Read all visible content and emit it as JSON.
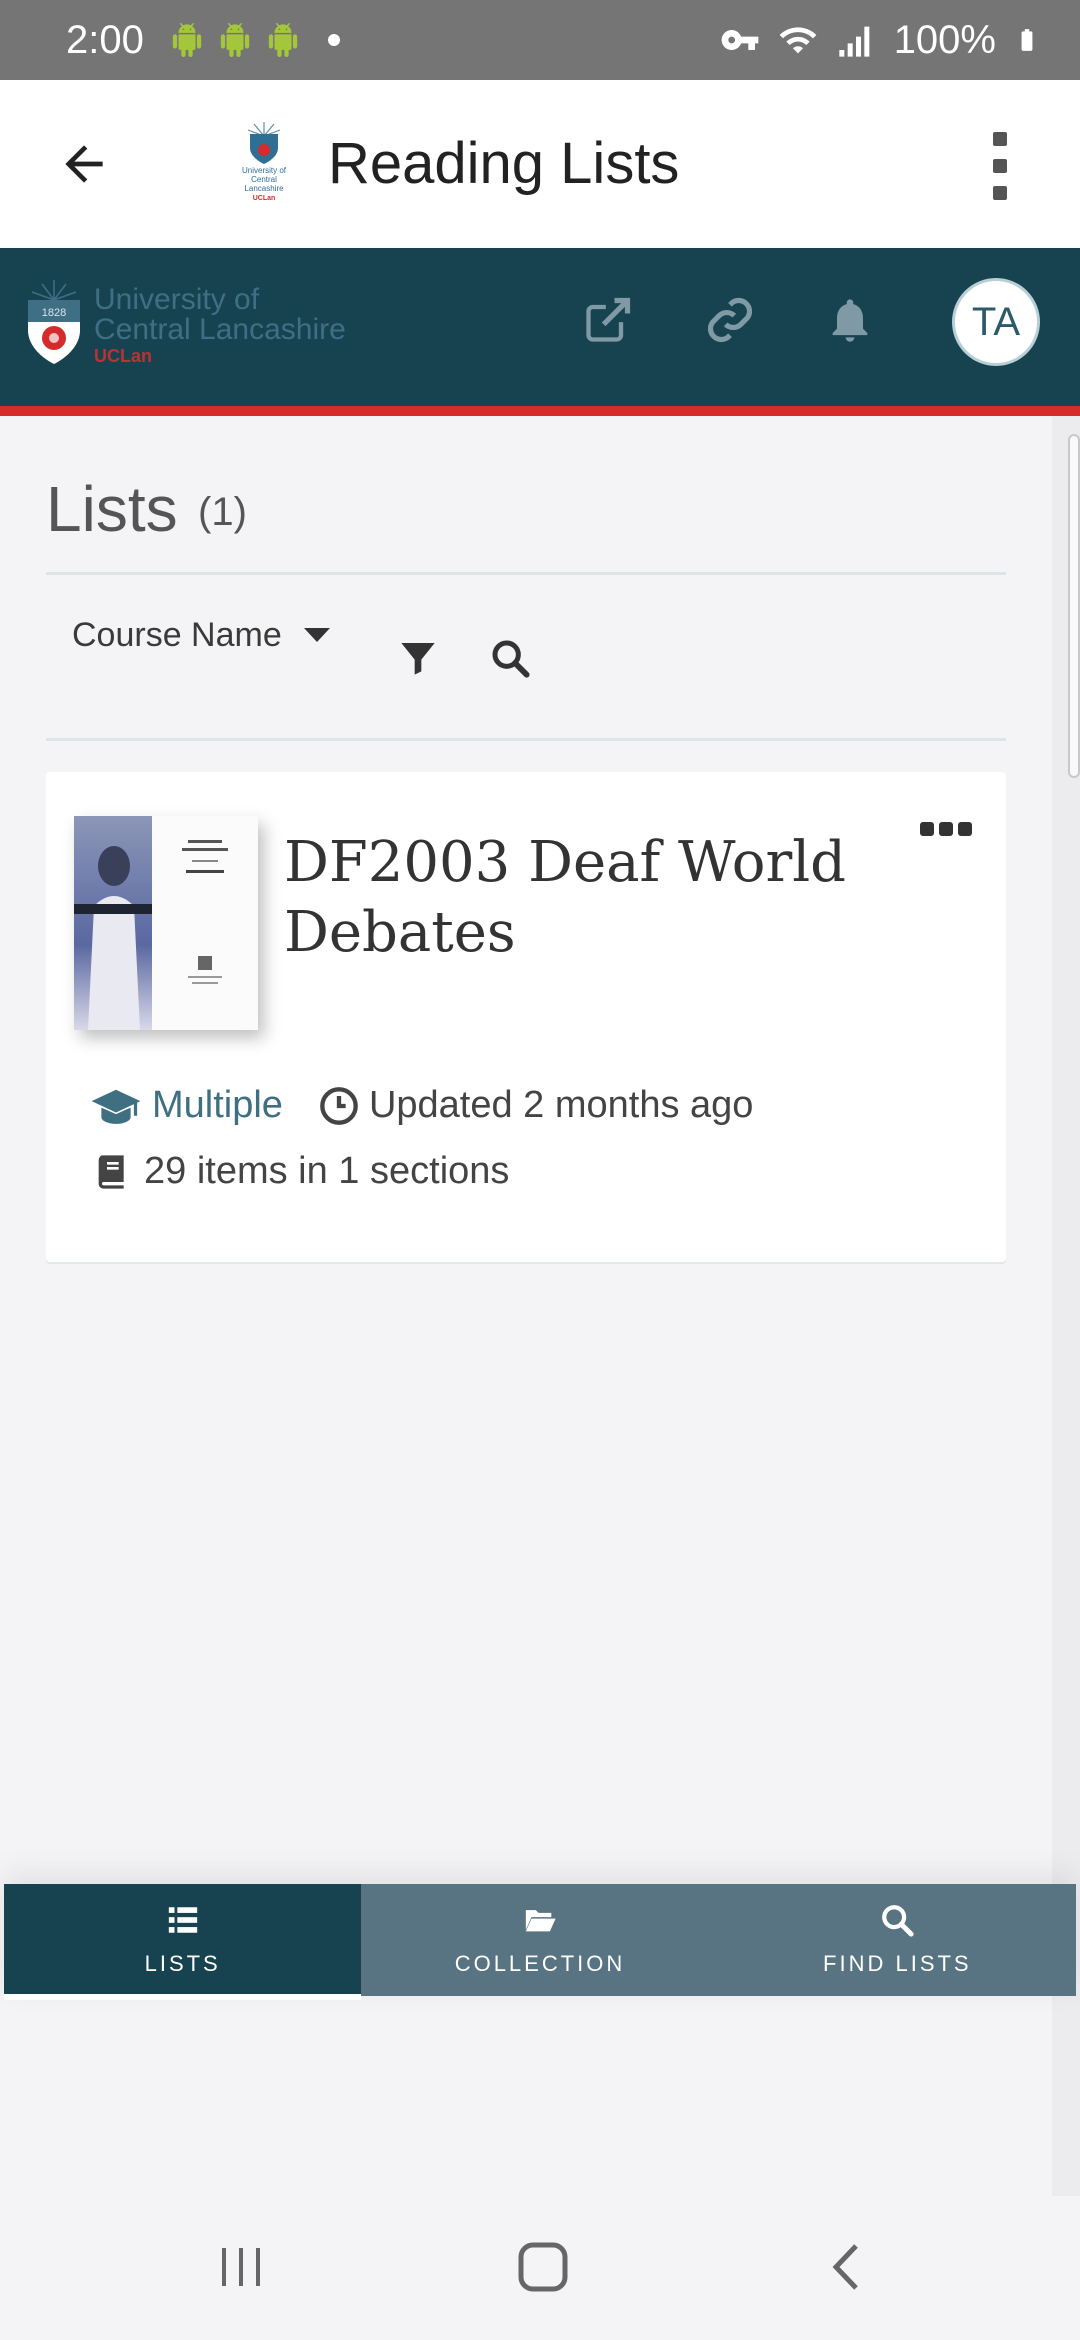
{
  "status_bar": {
    "time": "2:00",
    "battery": "100%"
  },
  "app_bar": {
    "title": "Reading Lists",
    "logo_text": [
      "University of",
      "Central",
      "Lancashire",
      "UCLan"
    ]
  },
  "brand": {
    "name_line1": "University of",
    "name_line2": "Central Lancashire",
    "name_line3": "UCLan",
    "crest_year": "1828",
    "avatar_initials": "TA",
    "colors": {
      "brand": "#16434f",
      "stripe": "#d52b2b",
      "nav_inactive": "#587382"
    }
  },
  "lists": {
    "heading": "Lists",
    "count": "(1)",
    "sort_label": "Course Name"
  },
  "card": {
    "title": "DF2003 Deaf World Debates",
    "course": "Multiple",
    "updated": "Updated 2 months ago",
    "items": "29 items in 1 sections"
  },
  "bottom_nav": {
    "items": [
      {
        "label": "LISTS",
        "icon": "list-icon",
        "active": true
      },
      {
        "label": "COLLECTION",
        "icon": "folder-open-icon",
        "active": false
      },
      {
        "label": "FIND LISTS",
        "icon": "search-icon",
        "active": false
      }
    ]
  }
}
